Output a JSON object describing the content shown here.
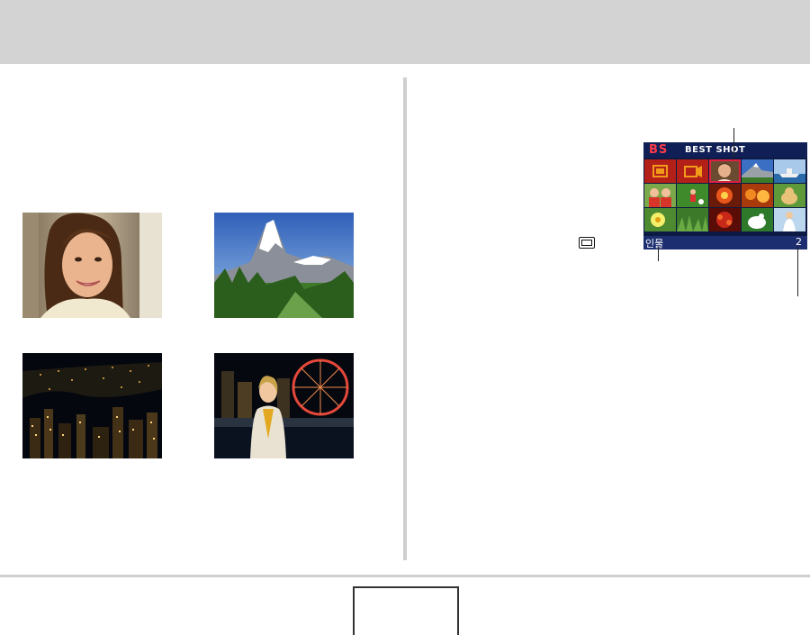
{
  "lcd": {
    "brand_mark": "BS",
    "title": "BEST SHOT",
    "scene_label": "인물",
    "page_number": "2",
    "colors": {
      "background": "#0c1a44",
      "accent": "#ff3b4a",
      "selection": "#e02040"
    },
    "grid": [
      {
        "kind": "auto-icon",
        "selected": false
      },
      {
        "kind": "movie-icon",
        "selected": false
      },
      {
        "kind": "portrait",
        "selected": true
      },
      {
        "kind": "scenery",
        "selected": false
      },
      {
        "kind": "ship",
        "selected": false
      },
      {
        "kind": "children",
        "selected": false
      },
      {
        "kind": "sports",
        "selected": false
      },
      {
        "kind": "candlelight",
        "selected": false
      },
      {
        "kind": "party",
        "selected": false
      },
      {
        "kind": "pet",
        "selected": false
      },
      {
        "kind": "flower",
        "selected": false
      },
      {
        "kind": "grass",
        "selected": false
      },
      {
        "kind": "fireworks",
        "selected": false
      },
      {
        "kind": "splash",
        "selected": false
      },
      {
        "kind": "bride",
        "selected": false
      }
    ]
  },
  "sample_photos": [
    {
      "name": "portrait"
    },
    {
      "name": "scenery"
    },
    {
      "name": "night-scene"
    },
    {
      "name": "night-portrait"
    }
  ],
  "icons": {
    "best_shot_icon": "camera-mode-icon"
  }
}
